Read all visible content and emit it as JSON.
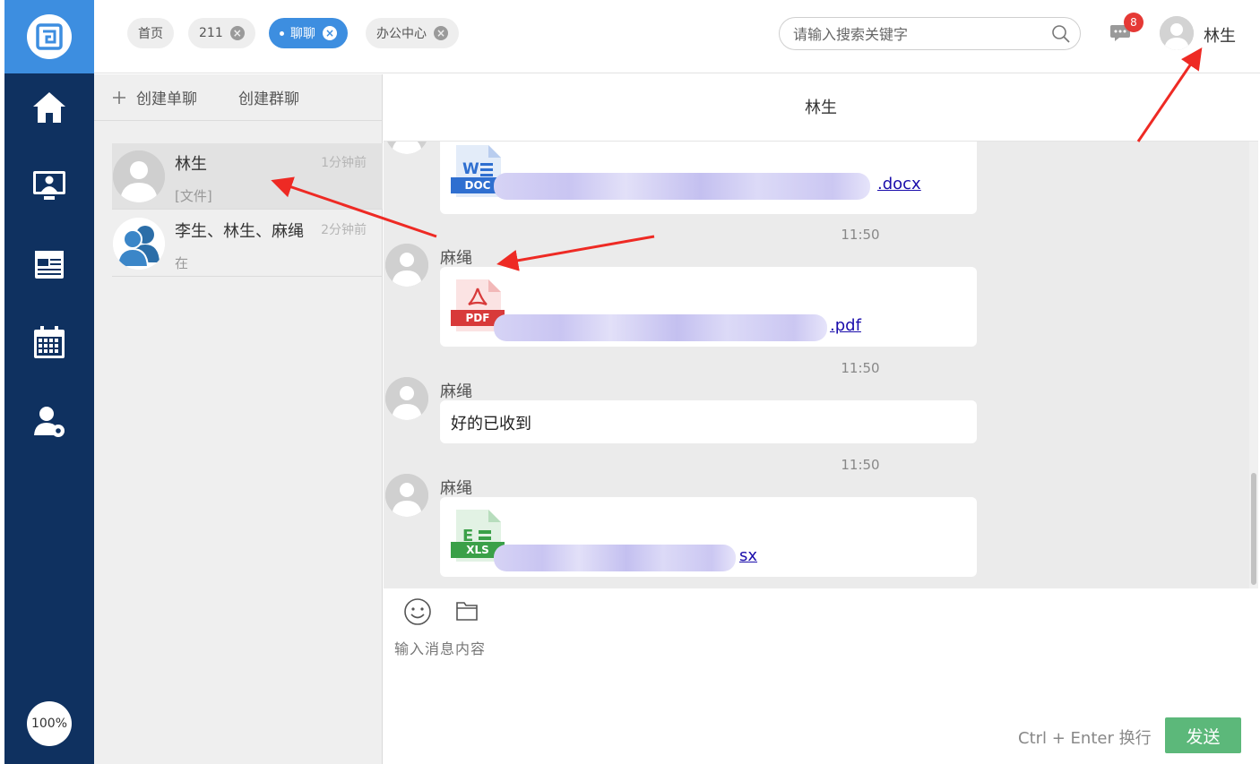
{
  "top_tabs": [
    {
      "label": "首页",
      "closable": false,
      "active": false
    },
    {
      "label": "211",
      "closable": true,
      "active": false
    },
    {
      "label": "聊聊",
      "closable": true,
      "active": true
    },
    {
      "label": "办公中心",
      "closable": true,
      "active": false
    }
  ],
  "tab_close_glyph": "×",
  "search": {
    "placeholder": "请输入搜索关键字"
  },
  "notifications": {
    "count": "8"
  },
  "user": {
    "name": "林生"
  },
  "rail": {
    "items": [
      "home-icon",
      "monitor-user-icon",
      "news-icon",
      "calendar-icon",
      "user-settings-icon"
    ],
    "zoom": "100%"
  },
  "sidebar": {
    "create_single": "创建单聊",
    "create_group": "创建群聊",
    "conversations": [
      {
        "name": "林生",
        "time": "1分钟前",
        "preview": "[文件]",
        "avatar": "user-avatar"
      },
      {
        "name": "李生、林生、麻绳",
        "time": "2分钟前",
        "preview": "在",
        "avatar": "group-avatar"
      }
    ]
  },
  "chat": {
    "title": "林生",
    "messages": [
      {
        "type": "file",
        "file_type": "DOC",
        "suffix": ".docx"
      },
      {
        "type": "file",
        "time": "11:50",
        "sender": "麻绳",
        "file_type": "PDF",
        "suffix": ".pdf"
      },
      {
        "type": "text",
        "time": "11:50",
        "sender": "麻绳",
        "text": "好的已收到"
      },
      {
        "type": "file",
        "time": "11:50",
        "sender": "麻绳",
        "file_type": "XLS",
        "suffix": "sx"
      }
    ]
  },
  "composer": {
    "placeholder": "输入消息内容",
    "hint": "Ctrl + Enter 换行",
    "send_label": "发送"
  },
  "colors": {
    "rail": "#0f3160",
    "brand": "#3d8ee0",
    "send": "#5cb87a",
    "badge": "#e53935",
    "annotation_arrow": "#ee2a24"
  }
}
